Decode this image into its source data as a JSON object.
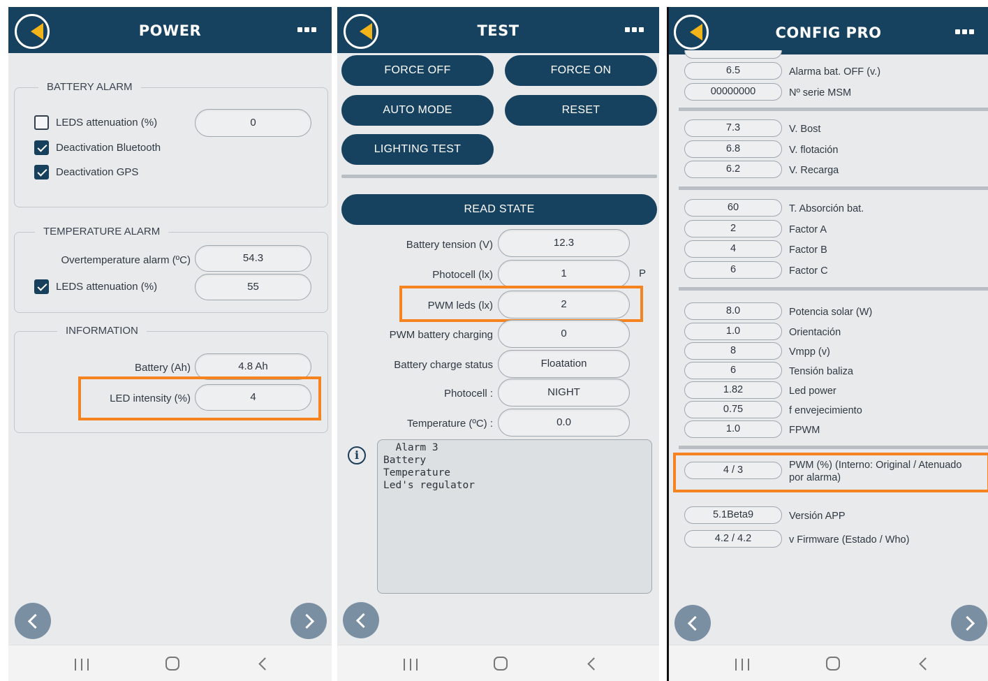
{
  "power": {
    "title": "POWER",
    "battery_alarm": {
      "legend": "BATTERY ALARM",
      "leds_attenuation_label": "LEDS attenuation (%)",
      "leds_attenuation_value": "0",
      "leds_attenuation_checked": false,
      "deactivation_bluetooth_label": "Deactivation Bluetooth",
      "deactivation_bluetooth_checked": true,
      "deactivation_gps_label": "Deactivation GPS",
      "deactivation_gps_checked": true
    },
    "temperature_alarm": {
      "legend": "TEMPERATURE ALARM",
      "overtemp_label": "Overtemperature alarm (ºC)",
      "overtemp_value": "54.3",
      "leds_attenuation_label": "LEDS attenuation (%)",
      "leds_attenuation_value": "55",
      "leds_attenuation_checked": true
    },
    "information": {
      "legend": "INFORMATION",
      "battery_label": "Battery (Ah)",
      "battery_value": "4.8 Ah",
      "led_intensity_label": "LED intensity (%)",
      "led_intensity_value": "4"
    }
  },
  "test": {
    "title": "TEST",
    "buttons": {
      "force_off": "FORCE OFF",
      "force_on": "FORCE ON",
      "auto_mode": "AUTO MODE",
      "reset": "RESET",
      "lighting_test": "LIGHTING TEST",
      "read_state": "READ STATE"
    },
    "fields": [
      {
        "label": "Battery tension (V)",
        "value": "12.3"
      },
      {
        "label": "Photocell (lx)",
        "value": "1"
      },
      {
        "label": "PWM leds (lx)",
        "value": "2"
      },
      {
        "label": "PWM battery charging",
        "value": "0"
      },
      {
        "label": "Battery charge status",
        "value": "Floatation"
      },
      {
        "label": "Photocell :",
        "value": "NIGHT"
      },
      {
        "label": "Temperature (ºC) :",
        "value": "0.0"
      }
    ],
    "photocell_suffix": "P",
    "info_icon": "i",
    "log_text": "  Alarm 3\nBattery\nTemperature\nLed's regulator"
  },
  "config": {
    "title": "CONFIG PRO",
    "rows": [
      {
        "value": "6.5",
        "label": "Alarma bat. OFF (v.)"
      },
      {
        "value": "00000000",
        "label": "Nº serie MSM"
      },
      {
        "value": "7.3",
        "label": "V. Bost"
      },
      {
        "value": "6.8",
        "label": "V. flotación"
      },
      {
        "value": "6.2",
        "label": "V. Recarga"
      },
      {
        "value": "60",
        "label": "T. Absorción bat."
      },
      {
        "value": "2",
        "label": "Factor A"
      },
      {
        "value": "4",
        "label": "Factor B"
      },
      {
        "value": "6",
        "label": "Factor C"
      },
      {
        "value": "8.0",
        "label": "Potencia solar (W)"
      },
      {
        "value": "1.0",
        "label": "Orientación"
      },
      {
        "value": "8",
        "label": "Vmpp (v)"
      },
      {
        "value": "6",
        "label": "Tensión baliza"
      },
      {
        "value": "1.82",
        "label": "Led power"
      },
      {
        "value": "0.75",
        "label": "f envejecimiento"
      },
      {
        "value": "1.0",
        "label": "FPWM"
      },
      {
        "value": "4 / 3",
        "label": "PWM (%) (Interno: Original / Atenuado por alarma)"
      },
      {
        "value": "5.1Beta9",
        "label": "Versión APP"
      },
      {
        "value": "4.2 / 4.2",
        "label": "v Firmware (Estado / Who)"
      }
    ]
  },
  "colors": {
    "header": "#16415f",
    "accent": "#f2b418",
    "highlight": "#f5831f",
    "nav_button": "#7b8fa3"
  },
  "icons": {
    "menu": "more-dots-icon",
    "logo": "app-logo-icon",
    "prev": "chevron-left-icon",
    "next": "chevron-right-icon",
    "sys_recent": "recent-apps-icon",
    "sys_home": "home-icon",
    "sys_back": "back-icon",
    "info": "info-icon"
  }
}
